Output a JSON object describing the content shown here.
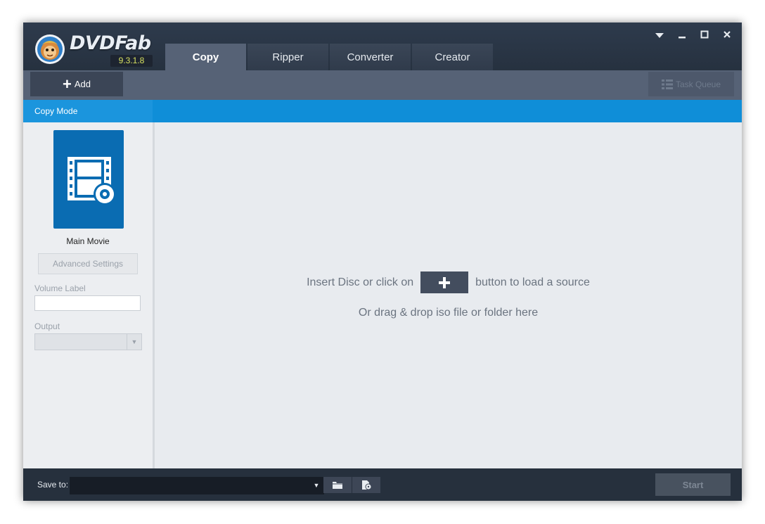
{
  "app": {
    "brand": "DVDFab",
    "version": "9.3.1.8"
  },
  "tabs": [
    {
      "label": "Copy",
      "active": true
    },
    {
      "label": "Ripper",
      "active": false
    },
    {
      "label": "Converter",
      "active": false
    },
    {
      "label": "Creator",
      "active": false
    }
  ],
  "window_controls": {
    "menu_icon": "triangle-down-icon",
    "minimize_icon": "minimize-icon",
    "maximize_icon": "maximize-icon",
    "close_icon": "close-icon"
  },
  "toolbar": {
    "add_label": "Add",
    "task_queue_label": "Task Queue"
  },
  "sidebar": {
    "section_title": "Copy Mode",
    "mode_name": "Main Movie",
    "advanced_settings_label": "Advanced Settings",
    "volume_label": "Volume Label",
    "volume_value": "",
    "output_label": "Output",
    "output_value": ""
  },
  "main": {
    "hint_before": "Insert Disc or click on",
    "hint_after": "button to load a source",
    "hint_drag": "Or drag & drop iso file or folder here"
  },
  "bottom": {
    "save_to_label": "Save to:",
    "save_to_value": "",
    "start_label": "Start"
  },
  "colors": {
    "accent_blue": "#0f8ed8",
    "tile_blue": "#0a6cb2",
    "titlebar": "#2e3b4d",
    "toolbar": "#566276"
  }
}
